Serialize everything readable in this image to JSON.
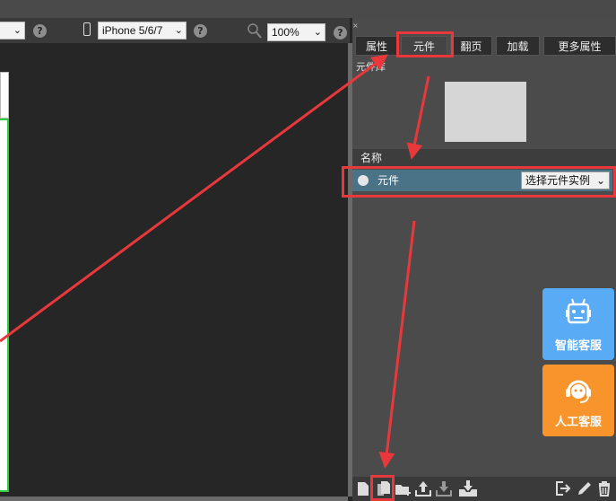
{
  "toolbar": {
    "device_select": "iPhone 5/6/7",
    "zoom_select": "100%",
    "help": "?"
  },
  "panel": {
    "tabs": [
      {
        "label": "属性"
      },
      {
        "label": "元件"
      },
      {
        "label": "翻页"
      },
      {
        "label": "加载"
      },
      {
        "label": "更多属性"
      }
    ],
    "library_label": "元件库",
    "name_header": "名称",
    "row": {
      "label": "元件",
      "select_value": "选择元件实例"
    },
    "service": {
      "smart": "智能客服",
      "human": "人工客服"
    }
  },
  "colors": {
    "accent_red": "#e8383c",
    "row_blue": "#4a7388",
    "smart_blue": "#5aabf5",
    "human_orange": "#f7952c",
    "artboard_green": "#2ecc40"
  },
  "icons": [
    "phone-icon",
    "search-icon",
    "help-icon",
    "chevron-down-icon",
    "new-page-icon",
    "duplicate-icon",
    "add-folder-icon",
    "upload-icon",
    "download-icon",
    "import-icon",
    "export-icon",
    "edit-icon",
    "delete-icon",
    "robot-icon",
    "headset-icon"
  ]
}
